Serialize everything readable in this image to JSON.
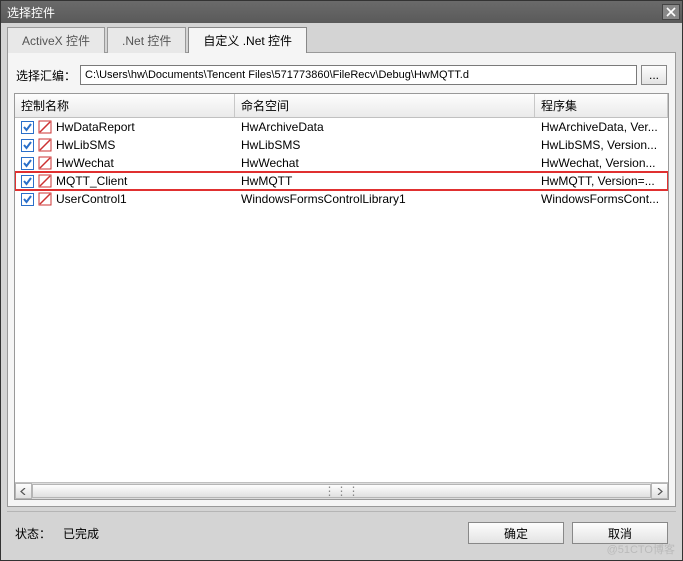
{
  "window": {
    "title": "选择控件"
  },
  "tabs": [
    {
      "label": "ActiveX 控件",
      "active": false
    },
    {
      "label": ".Net 控件",
      "active": false
    },
    {
      "label": "自定义 .Net 控件",
      "active": true
    }
  ],
  "path": {
    "label": "选择汇编：",
    "value": "C:\\Users\\hw\\Documents\\Tencent Files\\571773860\\FileRecv\\Debug\\HwMQTT.d",
    "browse": "..."
  },
  "columns": {
    "c1": "控制名称",
    "c2": "命名空间",
    "c3": "程序集"
  },
  "rows": [
    {
      "name": "HwDataReport",
      "ns": "HwArchiveData",
      "asm": "HwArchiveData, Ver...",
      "checked": true,
      "hl": false
    },
    {
      "name": "HwLibSMS",
      "ns": "HwLibSMS",
      "asm": "HwLibSMS, Version...",
      "checked": true,
      "hl": false
    },
    {
      "name": "HwWechat",
      "ns": "HwWechat",
      "asm": "HwWechat, Version...",
      "checked": true,
      "hl": false
    },
    {
      "name": "MQTT_Client",
      "ns": "HwMQTT",
      "asm": "HwMQTT, Version=...",
      "checked": true,
      "hl": true
    },
    {
      "name": "UserControl1",
      "ns": "WindowsFormsControlLibrary1",
      "asm": "WindowsFormsCont...",
      "checked": true,
      "hl": false
    }
  ],
  "footer": {
    "status_label": "状态：",
    "status_value": "已完成",
    "ok": "确定",
    "cancel": "取消"
  },
  "watermark": "@51CTO博客"
}
